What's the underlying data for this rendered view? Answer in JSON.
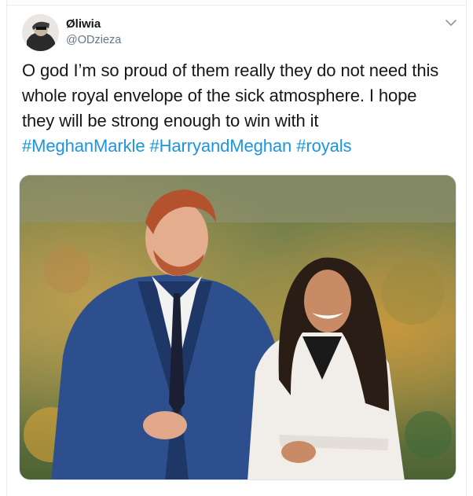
{
  "user": {
    "display_name": "Øliwia",
    "handle": "@ODzieza"
  },
  "tweet": {
    "text_line1": "O god I’m so proud of them really they do not need this",
    "text_line2": "whole royal envelope of the sick atmosphere. I hope",
    "text_line3": "they will be strong enough to win with it",
    "hashtags": [
      "#MeghanMarkle",
      "#HarryandMeghan",
      "#royals"
    ]
  },
  "icons": {
    "menu": "chevron-down-icon"
  },
  "colors": {
    "link": "#1b95e0",
    "secondary_text": "#657786",
    "primary_text": "#14171a",
    "border": "#e6ecf0"
  }
}
